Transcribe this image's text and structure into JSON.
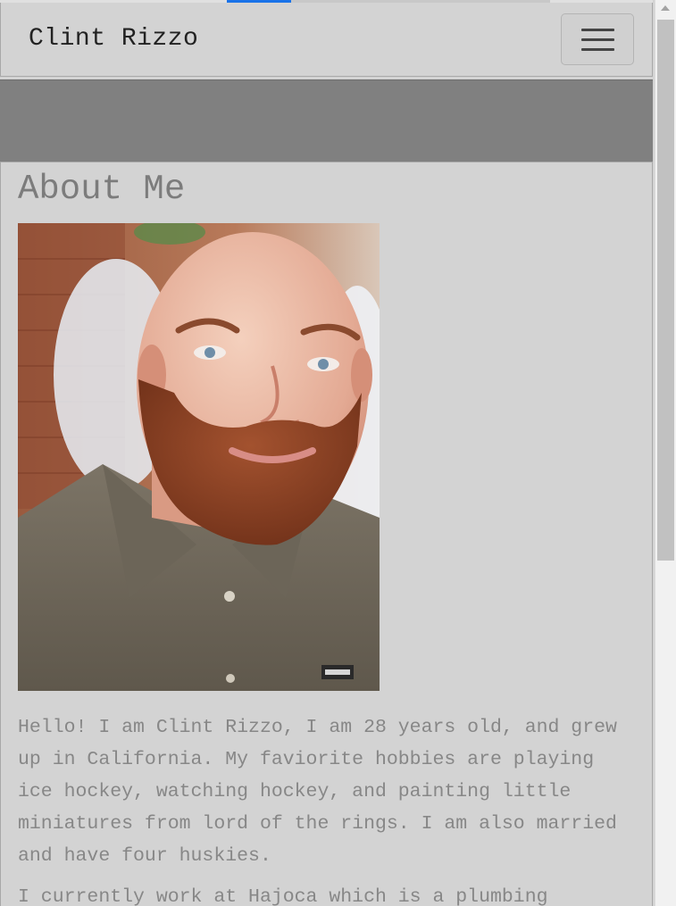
{
  "navbar": {
    "brand": "Clint Rizzo",
    "toggle_icon": "hamburger-menu-icon"
  },
  "about": {
    "heading": "About Me",
    "photo_alt": "Portrait photo of Clint Rizzo",
    "paragraphs": [
      "Hello! I am Clint Rizzo, I am 28 years old, and grew up in California. My faviorite hobbies are playing ice hockey, watching hockey, and painting little miniatures from lord of the rings. I am also married and have four huskies.",
      "I currently work at Hajoca which is a plumbing"
    ]
  },
  "colors": {
    "page_background": "#d3d3d3",
    "banner": "#808080",
    "heading_text": "#7c7c7c",
    "body_text": "#878787"
  }
}
